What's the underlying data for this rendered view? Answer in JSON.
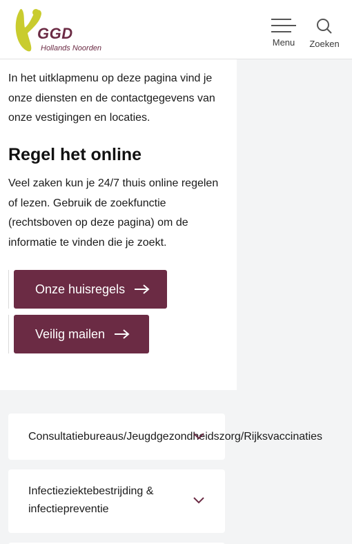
{
  "header": {
    "logo_name": "GGD",
    "logo_sub": "Hollands Noorden",
    "menu_label": "Menu",
    "search_label": "Zoeken"
  },
  "main": {
    "intro": "In het uitklapmenu op deze pagina vind je onze diensten en de contactgegevens van onze vestigingen en locaties.",
    "heading": "Regel het online",
    "paragraph": "Veel zaken kun je 24/7 thuis online regelen of lezen. Gebruik de zoekfunctie (rechtsboven op deze pagina) om de informatie te vinden die je zoekt.",
    "buttons": [
      {
        "label": "Onze huisregels"
      },
      {
        "label": "Veilig mailen"
      }
    ]
  },
  "accordion": [
    {
      "label": "Consultatiebureaus/Jeugdgezondheidszorg/Rijksvaccinaties"
    },
    {
      "label": "Infectieziektebestrijding & infectiepreventie"
    }
  ],
  "colors": {
    "brand": "#6b2b44",
    "logo_yellow": "#c9cc2e",
    "background": "#f3f4f5"
  },
  "icons": [
    "hamburger-menu-icon",
    "search-icon",
    "arrow-right-icon",
    "chevron-down-icon"
  ]
}
